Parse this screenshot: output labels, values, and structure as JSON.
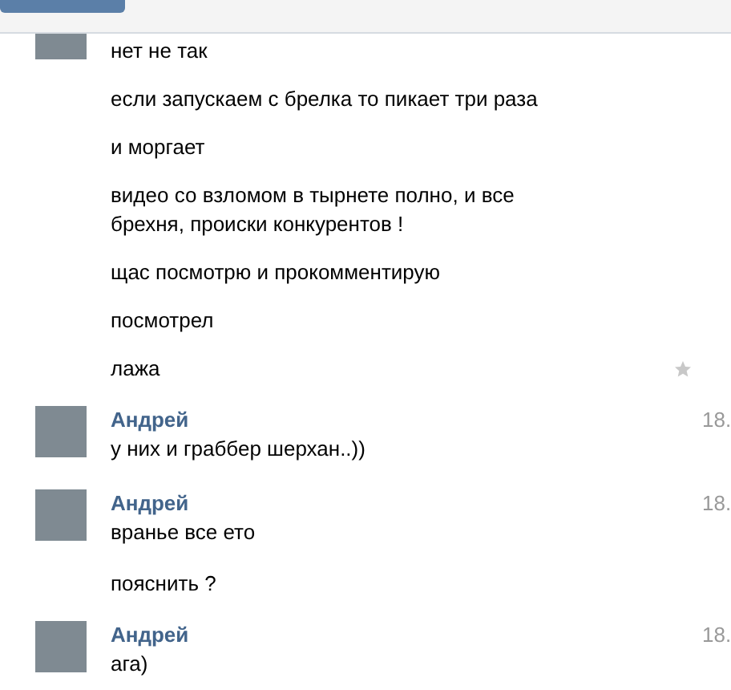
{
  "groups": [
    {
      "messages": [
        {
          "text": "нет не так",
          "starred": false
        },
        {
          "text": "если запускаем с брелка то пикает три раза",
          "starred": false
        },
        {
          "text": "и моргает",
          "starred": false
        },
        {
          "text": "видео со взломом в тырнете полно, и все брехня, происки конкурентов !",
          "starred": false
        },
        {
          "text": "щас посмотрю и прокомментирую",
          "starred": false
        },
        {
          "text": "посмотрел",
          "starred": false
        },
        {
          "text": "лажа",
          "starred": true
        }
      ]
    },
    {
      "author": "Андрей",
      "time": "18.",
      "messages": [
        {
          "text": "у них и граббер шерхан..))",
          "starred": false
        }
      ]
    },
    {
      "author": "Андрей",
      "time": "18.",
      "messages": [
        {
          "text": "вранье все ето",
          "starred": false
        },
        {
          "text": "пояснить ?",
          "starred": false
        }
      ]
    },
    {
      "author": "Андрей",
      "time": "18.",
      "messages": [
        {
          "text": "ага)",
          "starred": false
        }
      ]
    }
  ]
}
